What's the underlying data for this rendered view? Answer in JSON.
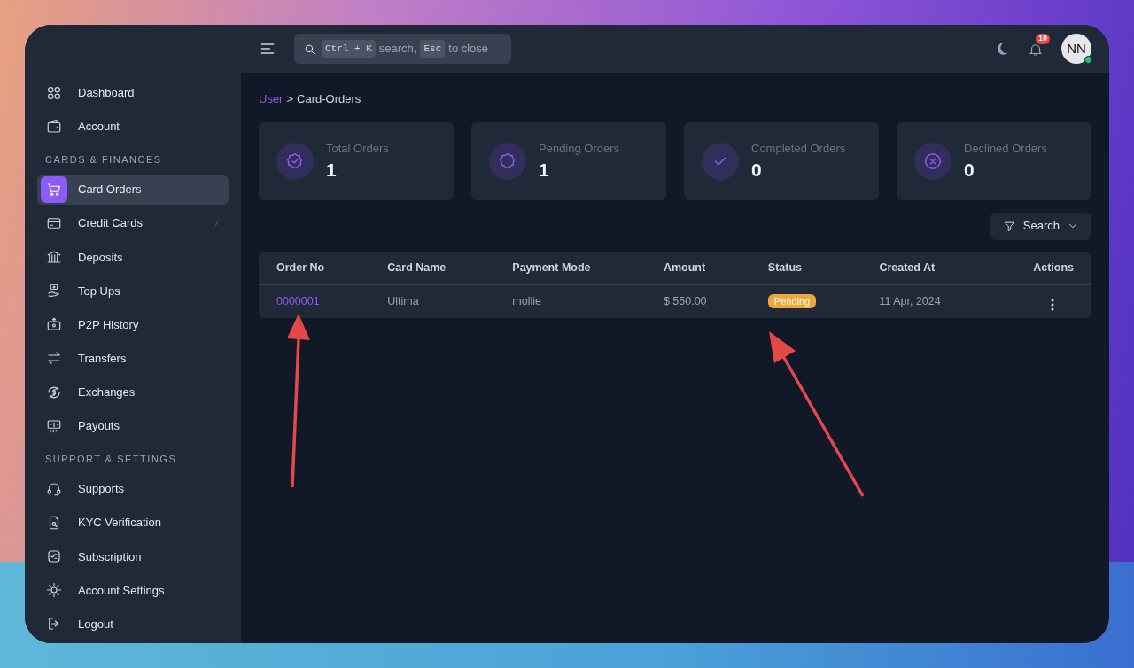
{
  "topbar": {
    "search": {
      "key_1": "Ctrl + K",
      "text_1": "search,",
      "key_2": "Esc",
      "text_2": "to close"
    },
    "notification_count": "10",
    "avatar": {
      "initials": "NN",
      "online": true
    }
  },
  "sidebar": {
    "groups": [
      {
        "items": [
          {
            "label": "Dashboard",
            "selected": false,
            "submenu": false
          },
          {
            "label": "Account",
            "selected": false,
            "submenu": false
          }
        ]
      },
      {
        "heading": "CARDS & FINANCES",
        "items": [
          {
            "label": "Card Orders",
            "selected": true,
            "submenu": false
          },
          {
            "label": "Credit Cards",
            "selected": false,
            "submenu": true
          },
          {
            "label": "Deposits",
            "selected": false,
            "submenu": false
          },
          {
            "label": "Top Ups",
            "selected": false,
            "submenu": false
          },
          {
            "label": "P2P History",
            "selected": false,
            "submenu": false
          },
          {
            "label": "Transfers",
            "selected": false,
            "submenu": false
          },
          {
            "label": "Exchanges",
            "selected": false,
            "submenu": false
          },
          {
            "label": "Payouts",
            "selected": false,
            "submenu": false
          }
        ]
      },
      {
        "heading": "SUPPORT & SETTINGS",
        "items": [
          {
            "label": "Supports",
            "selected": false,
            "submenu": false
          },
          {
            "label": "KYC Verification",
            "selected": false,
            "submenu": false
          },
          {
            "label": "Subscription",
            "selected": false,
            "submenu": false
          },
          {
            "label": "Account Settings",
            "selected": false,
            "submenu": false
          },
          {
            "label": "Logout",
            "selected": false,
            "submenu": false
          }
        ]
      }
    ]
  },
  "breadcrumb": [
    {
      "label": "User",
      "link": true
    },
    {
      "label": ">",
      "link": false
    },
    {
      "label": "Card-Orders",
      "link": false
    }
  ],
  "stats": [
    {
      "label": "Total Orders",
      "value": "1"
    },
    {
      "label": "Pending Orders",
      "value": "1"
    },
    {
      "label": "Completed Orders",
      "value": "0"
    },
    {
      "label": "Declined Orders",
      "value": "0"
    }
  ],
  "filter_button": "Search",
  "table": {
    "columns": [
      "Order No",
      "Card Name",
      "Payment Mode",
      "Amount",
      "Status",
      "Created At",
      "Actions"
    ],
    "rows": [
      {
        "order_no": "0000001",
        "card_name": "Ultima",
        "payment_mode": "mollie",
        "amount": "$ 550.00",
        "status": {
          "label": "Pending",
          "color": "#f0a73a"
        },
        "created_at": "11 Apr, 2024"
      }
    ]
  }
}
